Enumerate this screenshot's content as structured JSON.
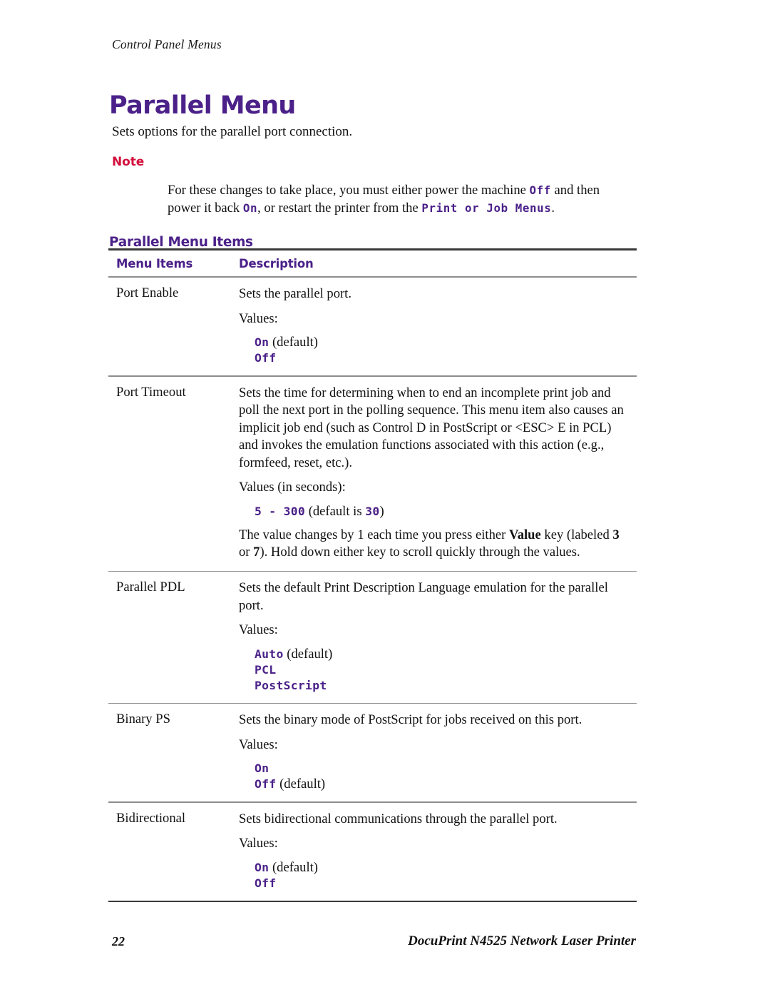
{
  "running_head": "Control Panel Menus",
  "chapter_title": "Parallel Menu",
  "intro": "Sets options for the parallel port connection.",
  "note": {
    "label": "Note",
    "line1_a": "For these changes to take place, you must either power the machine ",
    "line1_code": "Off",
    "line1_b": " and then power it back ",
    "line2_code": "On",
    "line2_b": ", or restart the printer from the ",
    "line2_code2": "Print or Job Menus",
    "line2_c": "."
  },
  "sub_heading": "Parallel Menu Items",
  "table": {
    "headers": {
      "menu_items": "Menu Items",
      "description": "Description"
    },
    "rows": [
      {
        "item": "Port Enable",
        "desc": "Sets the parallel port.",
        "values_label": "Values:",
        "values": [
          {
            "code": "On",
            "suffix": " (default)"
          },
          {
            "code": "Off",
            "suffix": ""
          }
        ]
      },
      {
        "item": "Port Timeout",
        "desc": "Sets the time for determining when to end an incomplete print job and poll the next port in the polling sequence. This menu item also causes an implicit job end (such as Control D in PostScript or <ESC> E in PCL) and invokes the emulation functions associated with this action (e.g., formfeed, reset, etc.).",
        "values_label": "Values (in seconds):",
        "range_code": "5 - 300",
        "range_mid": " (default is ",
        "range_default": "30",
        "range_end": ")",
        "note_a": "The value changes by 1 each time you press either ",
        "note_value_key": "Value",
        "note_b": " key (labeled ",
        "note_key1": "3",
        "note_c": " or ",
        "note_key2": "7",
        "note_d": "). Hold down either key to scroll quickly through the values."
      },
      {
        "item": "Parallel PDL",
        "desc": "Sets the default Print Description Language emulation for the parallel port.",
        "values_label": "Values:",
        "values": [
          {
            "code": "Auto",
            "suffix": " (default)"
          },
          {
            "code": "PCL",
            "suffix": ""
          },
          {
            "code": "PostScript",
            "suffix": ""
          }
        ]
      },
      {
        "item": "Binary PS",
        "desc": "Sets the binary mode of PostScript for jobs received on this port.",
        "values_label": "Values:",
        "values": [
          {
            "code": "On",
            "suffix": ""
          },
          {
            "code": "Off",
            "suffix": " (default)"
          }
        ]
      },
      {
        "item": "Bidirectional",
        "desc": "Sets bidirectional communications through the parallel port.",
        "values_label": "Values:",
        "values": [
          {
            "code": "On",
            "suffix": " (default)"
          },
          {
            "code": "Off",
            "suffix": ""
          }
        ]
      }
    ]
  },
  "footer": {
    "page_number": "22",
    "product": "DocuPrint N4525 Network Laser Printer"
  },
  "colors": {
    "heading_purple": "#4B2189",
    "note_red": "#D2103C",
    "rule_dark": "#3a3a3a",
    "rule_light": "#8d8d8d"
  }
}
